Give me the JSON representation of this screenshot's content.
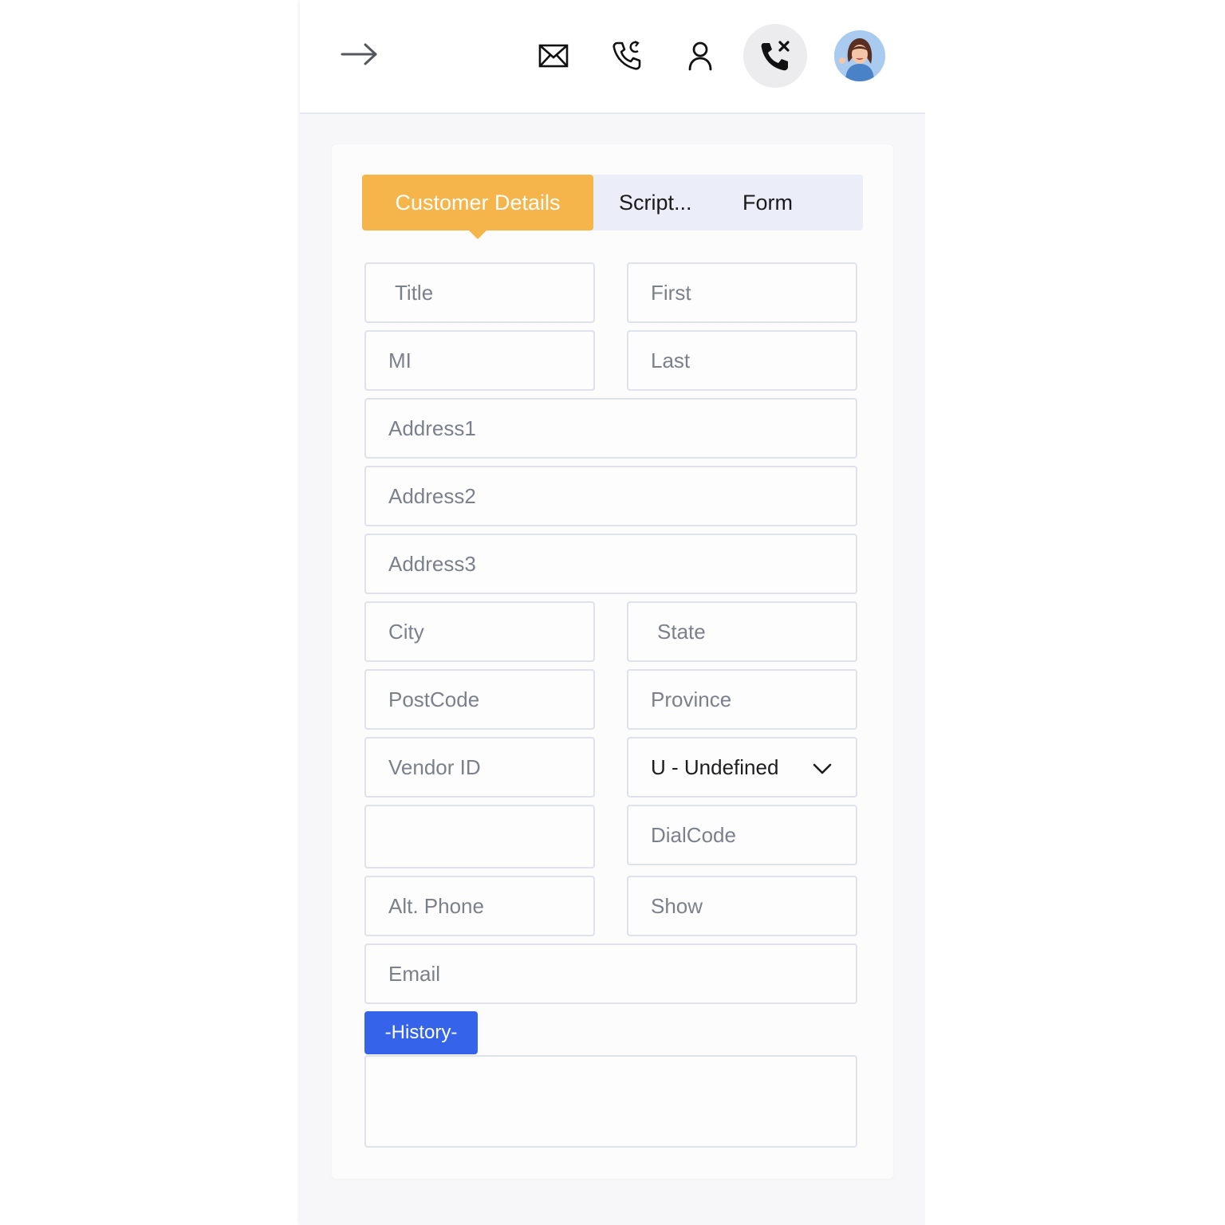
{
  "header": {
    "collapse_icon": "arrow-right-icon",
    "icons": [
      "mail-icon",
      "phone-callback-icon",
      "user-icon",
      "phone-hangup-icon"
    ],
    "avatar": "user-avatar"
  },
  "tabs": [
    {
      "label": "Customer Details",
      "active": true
    },
    {
      "label": "Script..."
    },
    {
      "label": "Form"
    }
  ],
  "form": {
    "title": "Title",
    "first": "First",
    "mi": "MI",
    "last": "Last",
    "address1": "Address1",
    "address2": "Address2",
    "address3": "Address3",
    "city": "City",
    "state": "State",
    "postcode": "PostCode",
    "province": "Province",
    "vendor_id": "Vendor ID",
    "gender_selected": "U - Undefined",
    "phone": "",
    "dialcode": "DialCode",
    "alt_phone": "Alt. Phone",
    "show": "Show",
    "email": "Email"
  },
  "history": {
    "button_label": "-History-"
  },
  "colors": {
    "active_tab": "#f5b54a",
    "history_button": "#3563e9",
    "tab_bar": "#ebeef8"
  }
}
